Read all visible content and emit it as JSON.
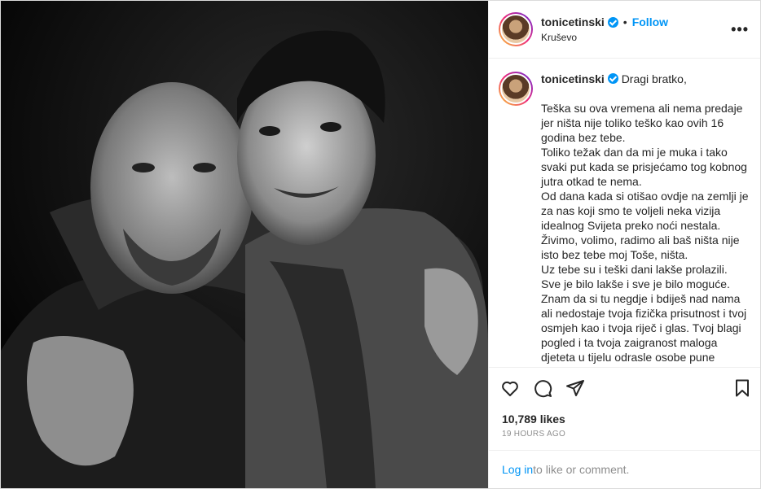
{
  "post": {
    "username": "tonicetinski",
    "follow_label": "Follow",
    "separator": "•",
    "location": "Kruševo",
    "more_label": "•••"
  },
  "caption": {
    "username": "tonicetinski",
    "greeting": "Dragi bratko,",
    "text": "Teška su ova vremena ali nema predaje jer ništa nije toliko teško kao ovih 16 godina bez tebe.\nToliko težak dan da mi je muka i tako svaki put kada se prisjećamo tog kobnog jutra otkad te nema.\nOd dana kada si otišao ovdje na zemlji je za nas koji smo te voljeli neka vizija idealnog Svijeta preko noći nestala.\nŽivimo, volimo, radimo ali baš ništa nije isto bez tebe moj Toše, ništa.\nUz tebe su i teški dani lakše prolazili.\nSve je bilo lakše i sve je bilo moguće.\nZnam da si tu negdje i bdiješ nad nama ali nedostaje tvoja fizička prisutnost i tvoj osmjeh kao i tvoja riječ i glas. Tvoj blagi pogled i ta tvoja zaigranost maloga djeteta u tijelu odrasle osobe pune razumijevanja za"
  },
  "stats": {
    "likes": "10,789 likes",
    "time": "19 HOURS AGO"
  },
  "footer": {
    "login_link": "Log in",
    "login_rest": " to like or comment."
  },
  "icons": [
    "heart-icon",
    "comment-icon",
    "share-icon",
    "bookmark-icon",
    "verified-icon",
    "more-icon"
  ],
  "colors": {
    "accent": "#0095f6",
    "muted": "#8e8e8e",
    "text": "#262626"
  }
}
